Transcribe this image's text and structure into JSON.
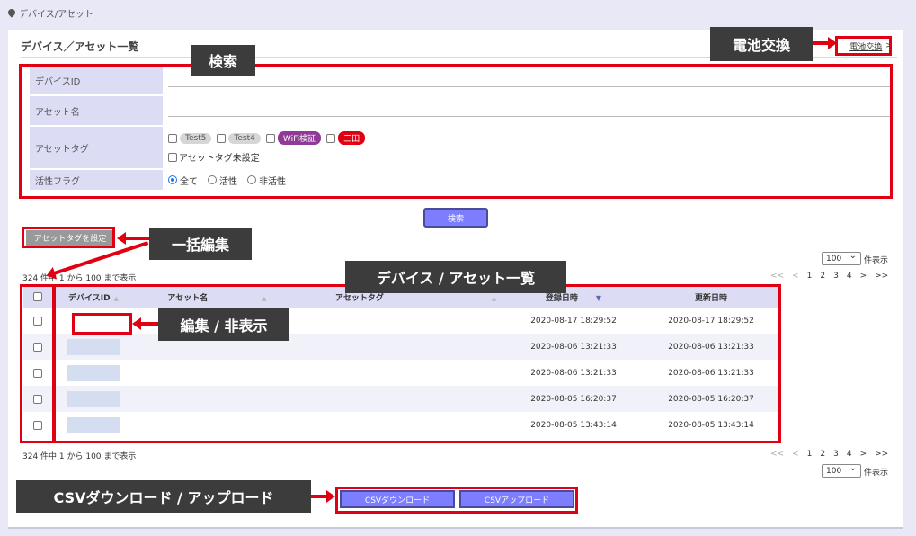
{
  "breadcrumb": "デバイス/アセット",
  "page_title": "デバイス／アセット一覧",
  "battery_link": {
    "label": "電池交換",
    "chevron": ">"
  },
  "callouts": {
    "battery": "電池交換",
    "search": "検索",
    "bulk_edit": "一括編集",
    "list": "デバイス / アセット一覧",
    "edit_hide": "編集 / 非表示",
    "csv": "CSVダウンロード / アップロード"
  },
  "search": {
    "device_id_label": "デバイスID",
    "device_id_value": "",
    "asset_name_label": "アセット名",
    "asset_name_value": "",
    "asset_tag_label": "アセットタグ",
    "tags": [
      {
        "label": "Test5",
        "bg": "#d6d6d6",
        "fg": "#555555"
      },
      {
        "label": "Test4",
        "bg": "#d6d6d6",
        "fg": "#555555"
      },
      {
        "label": "WiFi検証",
        "bg": "#8e3a96",
        "fg": "#ffffff"
      },
      {
        "label": "三田",
        "bg": "#e00012",
        "fg": "#ffffff"
      }
    ],
    "untagged_label": "アセットタグ未設定",
    "active_flag_label": "活性フラグ",
    "radios": [
      {
        "label": "全て",
        "checked": true
      },
      {
        "label": "活性",
        "checked": false
      },
      {
        "label": "非活性",
        "checked": false
      }
    ],
    "search_button": "検索"
  },
  "set_tag_button": "アセットタグを設定",
  "per_page": {
    "value": "100",
    "suffix": "件表示"
  },
  "count_text": "324 件中 1 から 100 まで表示",
  "pager": [
    "<<",
    "<",
    "1",
    "2",
    "3",
    "4",
    ">",
    ">>"
  ],
  "table": {
    "columns": [
      "デバイスID",
      "アセット名",
      "アセットタグ",
      "登録日時",
      "更新日時"
    ],
    "rows": [
      {
        "device_id": "",
        "asset_name": "",
        "asset_tag": "",
        "registered": "2020-08-17 18:29:52",
        "updated": "2020-08-17 18:29:52"
      },
      {
        "device_id": "",
        "asset_name": "",
        "asset_tag": "",
        "registered": "2020-08-06 13:21:33",
        "updated": "2020-08-06 13:21:33"
      },
      {
        "device_id": "",
        "asset_name": "",
        "asset_tag": "",
        "registered": "2020-08-06 13:21:33",
        "updated": "2020-08-06 13:21:33"
      },
      {
        "device_id": "",
        "asset_name": "",
        "asset_tag": "",
        "registered": "2020-08-05 16:20:37",
        "updated": "2020-08-05 16:20:37"
      },
      {
        "device_id": "",
        "asset_name": "",
        "asset_tag": "",
        "registered": "2020-08-05 13:43:14",
        "updated": "2020-08-05 13:43:14"
      }
    ]
  },
  "csv_download": "CSVダウンロード",
  "csv_upload": "CSVアップロード",
  "colors": {
    "accent_button": "#7d7dff",
    "highlight_red": "#e00012",
    "label_bg": "#dcdcf5",
    "callout_bg": "#3c3c3c"
  }
}
